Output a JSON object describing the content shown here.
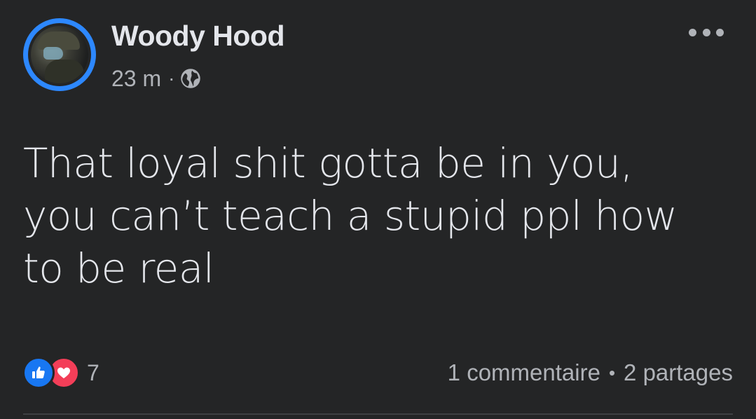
{
  "post": {
    "author": {
      "name": "Woody Hood",
      "time": "23 m",
      "separator": "·",
      "privacy_icon": "globe-icon"
    },
    "more_icon": "more-horizontal-icon",
    "text_lines": [
      "That loyal shit gotta be in you,",
      "you can’t teach a stupid ppl how",
      "to be real"
    ],
    "reactions": {
      "icons": [
        "like-icon",
        "love-icon"
      ],
      "count": "7"
    },
    "stats": {
      "comments": "1 commentaire",
      "separator": "•",
      "shares": "2 partages"
    }
  },
  "colors": {
    "background": "#242526",
    "primary_text": "#e4e6eb",
    "secondary_text": "#b0b3b8",
    "accent_ring": "#2d88ff",
    "like": "#1877f2",
    "love": "#f33e58"
  }
}
